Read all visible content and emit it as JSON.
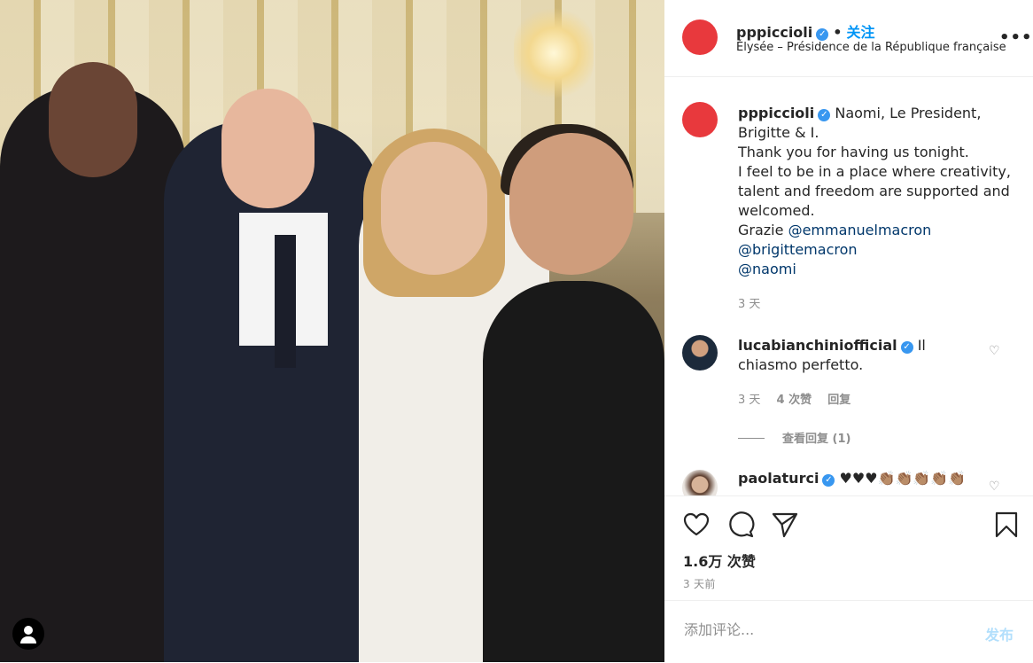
{
  "header": {
    "username": "pppiccioli",
    "follow_label": "关注",
    "location": "Élysée – Présidence de la République française"
  },
  "caption": {
    "username": "pppiccioli",
    "lines": [
      "Naomi, Le President,",
      "Brigitte & I.",
      "Thank you for having us tonight.",
      "I feel to be in a place where creativity, talent and freedom are supported and welcomed.",
      "Grazie "
    ],
    "mentions": [
      "@emmanuelmacron",
      "@brigittemacron",
      "@naomi"
    ],
    "time": "3 天"
  },
  "comments": [
    {
      "username": "lucabianchiniofficial",
      "text": "Il chiasmo perfetto.",
      "time": "3 天",
      "likes": "4 次赞",
      "reply": "回复",
      "view_replies": "查看回复 (1)"
    },
    {
      "username": "paolaturci",
      "text": "♥♥♥👏🏽👏🏽👏🏽👏🏽👏🏽"
    }
  ],
  "actions": {
    "likes": "1.6万 次赞",
    "posted_ago": "3 天前"
  },
  "add_comment": {
    "placeholder": "添加评论...",
    "post_label": "发布"
  },
  "colors": {
    "link": "#0095f6",
    "mention": "#00376b",
    "verified": "#3897f0",
    "avatar": "#e8393d"
  }
}
